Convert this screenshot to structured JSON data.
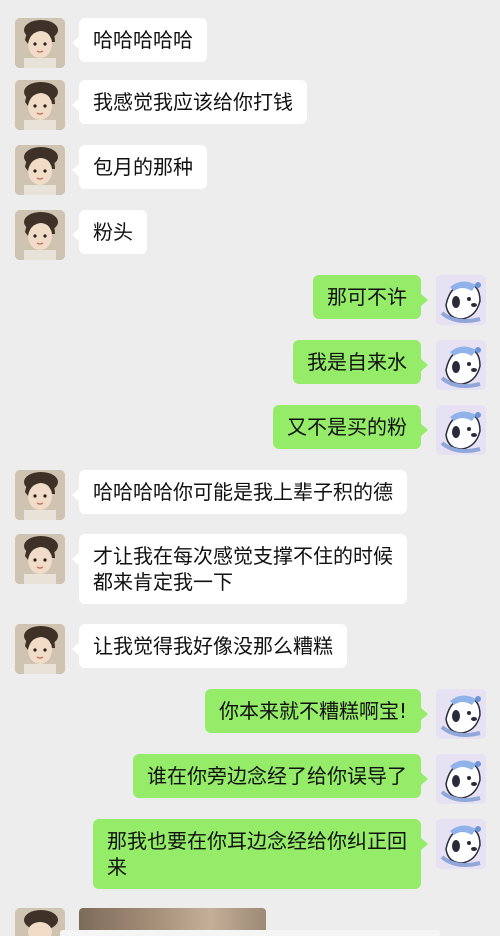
{
  "chat": {
    "messages": [
      {
        "side": "left",
        "text": "哈哈哈哈哈"
      },
      {
        "side": "left",
        "text": "我感觉我应该给你打钱"
      },
      {
        "side": "left",
        "text": "包月的那种"
      },
      {
        "side": "left",
        "text": "粉头"
      },
      {
        "side": "right",
        "text": "那可不许"
      },
      {
        "side": "right",
        "text": "我是自来水"
      },
      {
        "side": "right",
        "text": "又不是买的粉"
      },
      {
        "side": "left",
        "text": "哈哈哈哈你可能是我上辈子积的德"
      },
      {
        "side": "left",
        "text": "才让我在每次感觉支撑不住的时候\n都来肯定我一下"
      },
      {
        "side": "left",
        "text": "让我觉得我好像没那么糟糕"
      },
      {
        "side": "right",
        "text": "你本来就不糟糕啊宝!"
      },
      {
        "side": "right",
        "text": "谁在你旁边念经了给你误导了"
      },
      {
        "side": "right",
        "text": "那我也要在你耳边念经给你纠正回\n来"
      }
    ]
  },
  "colors": {
    "background": "#ededed",
    "incoming_bubble": "#ffffff",
    "outgoing_bubble": "#95ec69"
  },
  "icons": {
    "incoming_avatar": "girl-photo-avatar",
    "outgoing_avatar": "cartoon-dog-avatar"
  }
}
